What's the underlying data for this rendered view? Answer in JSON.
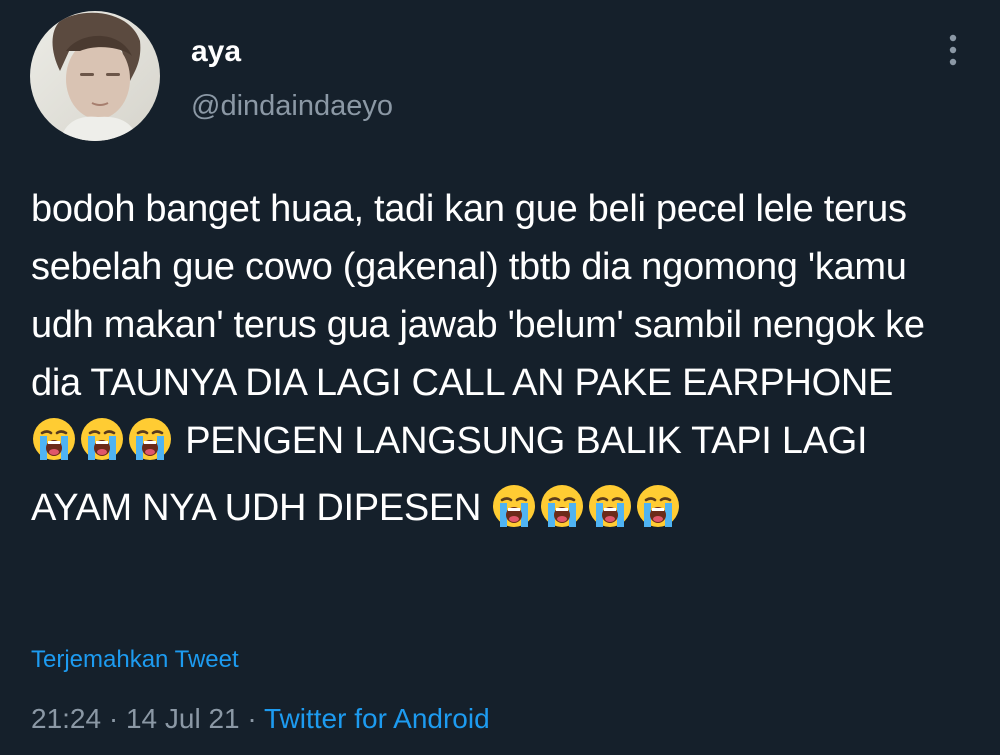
{
  "author": {
    "display_name": "aya",
    "handle": "@dindaindaeyo"
  },
  "tweet": {
    "text_part1": "bodoh banget huaa, tadi kan gue beli pecel lele terus sebelah gue cowo (gakenal) tbtb dia ngomong 'kamu udh makan' terus gua jawab 'belum' sambil nengok ke dia TAUNYA DIA LAGI CALL AN PAKE EARPHONE ",
    "emoji_run1": 3,
    "text_part2": " PENGEN LANGSUNG BALIK TAPI LAGI AYAM NYA UDH DIPESEN ",
    "emoji_run2": 4,
    "emoji_name": "loudly-crying-face"
  },
  "translate_label": "Terjemahkan Tweet",
  "meta": {
    "time": "21:24",
    "sep1": " · ",
    "date": "14 Jul 21",
    "sep2": " · ",
    "source": "Twitter for Android"
  },
  "icons": {
    "more": "vertical-ellipsis-icon",
    "avatar": "profile-photo"
  },
  "colors": {
    "background": "#15202b",
    "text": "#ffffff",
    "secondary": "#8b98a5",
    "link": "#1d9bf0"
  }
}
